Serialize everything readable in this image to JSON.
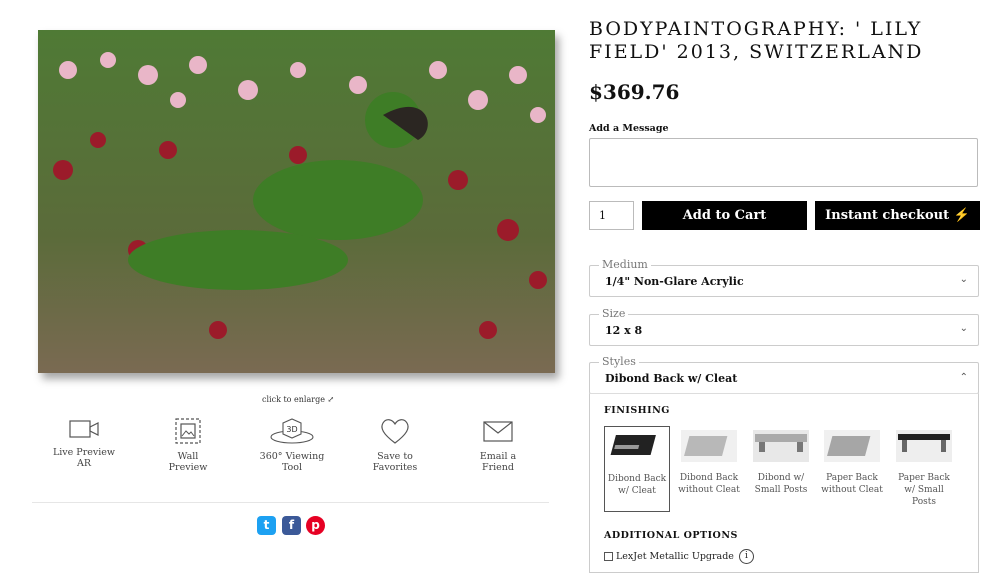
{
  "product": {
    "title": "BODYPAINTOGRAPHY: ' LILY FIELD' 2013, SWITZERLAND",
    "price": "$369.76",
    "image_caption": "click to enlarge ⤢"
  },
  "tools": [
    {
      "label": "Live Preview AR",
      "icon": "camera-icon"
    },
    {
      "label": "Wall Preview",
      "icon": "wall-frame-icon"
    },
    {
      "label": "360° Viewing Tool",
      "icon": "3d-cube-icon"
    },
    {
      "label": "Save to Favorites",
      "icon": "heart-icon"
    },
    {
      "label": "Email a Friend",
      "icon": "envelope-icon"
    }
  ],
  "social": [
    {
      "name": "twitter-icon",
      "glyph": "t",
      "color": "#1da1f2"
    },
    {
      "name": "facebook-icon",
      "glyph": "f",
      "color": "#3b5998"
    },
    {
      "name": "pinterest-icon",
      "glyph": "p",
      "color": "#e60023"
    }
  ],
  "order": {
    "message_label": "Add a Message",
    "message_value": "",
    "quantity": "1",
    "add_to_cart": "Add to Cart",
    "instant_checkout": "Instant checkout ⚡"
  },
  "options": {
    "medium": {
      "label": "Medium",
      "value": "1/4\" Non-Glare Acrylic"
    },
    "size": {
      "label": "Size",
      "value": "12 x 8"
    },
    "styles": {
      "label": "Styles",
      "value": "Dibond Back w/ Cleat"
    }
  },
  "finishing": {
    "heading": "FINISHING",
    "items": [
      {
        "label": "Dibond Back w/ Cleat",
        "selected": true
      },
      {
        "label": "Dibond Back without Cleat",
        "selected": false
      },
      {
        "label": "Dibond w/ Small Posts",
        "selected": false
      },
      {
        "label": "Paper Back without Cleat",
        "selected": false
      },
      {
        "label": "Paper Back w/ Small Posts",
        "selected": false
      }
    ]
  },
  "additional": {
    "heading": "ADDITIONAL OPTIONS",
    "lexjet": "LexJet Metallic Upgrade",
    "info": "i"
  },
  "colors": {
    "button_bg": "#000000",
    "button_text": "#ffffff"
  }
}
